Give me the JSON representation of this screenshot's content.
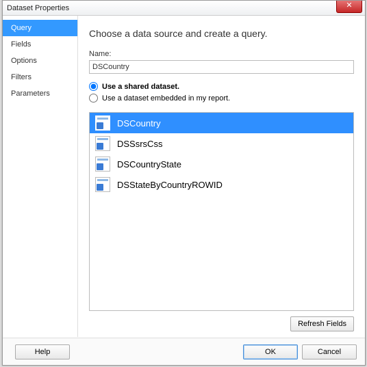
{
  "window": {
    "title": "Dataset Properties"
  },
  "sidebar": {
    "items": [
      {
        "label": "Query"
      },
      {
        "label": "Fields"
      },
      {
        "label": "Options"
      },
      {
        "label": "Filters"
      },
      {
        "label": "Parameters"
      }
    ]
  },
  "main": {
    "heading": "Choose a data source and create a query.",
    "name_label": "Name:",
    "name_value": "DSCountry",
    "radio_shared": "Use a shared dataset.",
    "radio_embedded": "Use a dataset embedded in my report.",
    "datasets": [
      {
        "label": "DSCountry"
      },
      {
        "label": "DSSsrsCss"
      },
      {
        "label": "DSCountryState"
      },
      {
        "label": "DSStateByCountryROWID"
      }
    ],
    "refresh_label": "Refresh Fields"
  },
  "footer": {
    "help": "Help",
    "ok": "OK",
    "cancel": "Cancel"
  }
}
